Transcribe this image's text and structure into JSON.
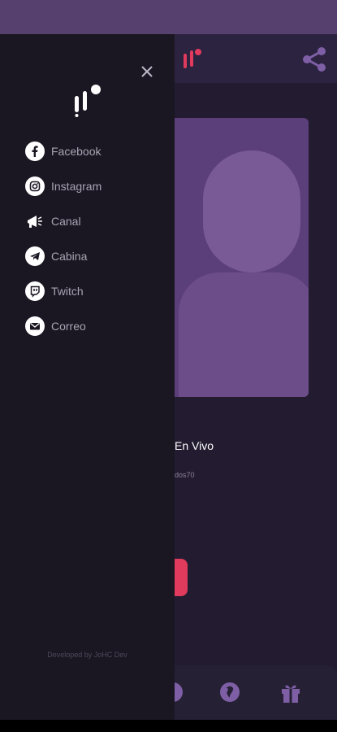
{
  "app": {
    "now_playing_title": "En Vivo",
    "now_playing_sub": "dos70"
  },
  "drawer": {
    "menu": [
      {
        "label": "Facebook",
        "icon": "facebook-icon"
      },
      {
        "label": "Instagram",
        "icon": "instagram-icon"
      },
      {
        "label": "Canal",
        "icon": "megaphone-icon"
      },
      {
        "label": "Cabina",
        "icon": "telegram-icon"
      },
      {
        "label": "Twitch",
        "icon": "twitch-icon"
      },
      {
        "label": "Correo",
        "icon": "mail-icon"
      }
    ],
    "credit": "Developed by JoHC Dev"
  },
  "colors": {
    "accent": "#e03a5c",
    "drawer_bg": "#1b1722",
    "app_bg": "#231c31",
    "status_bar": "#56406e",
    "icon_purple": "#7e5fa6"
  }
}
